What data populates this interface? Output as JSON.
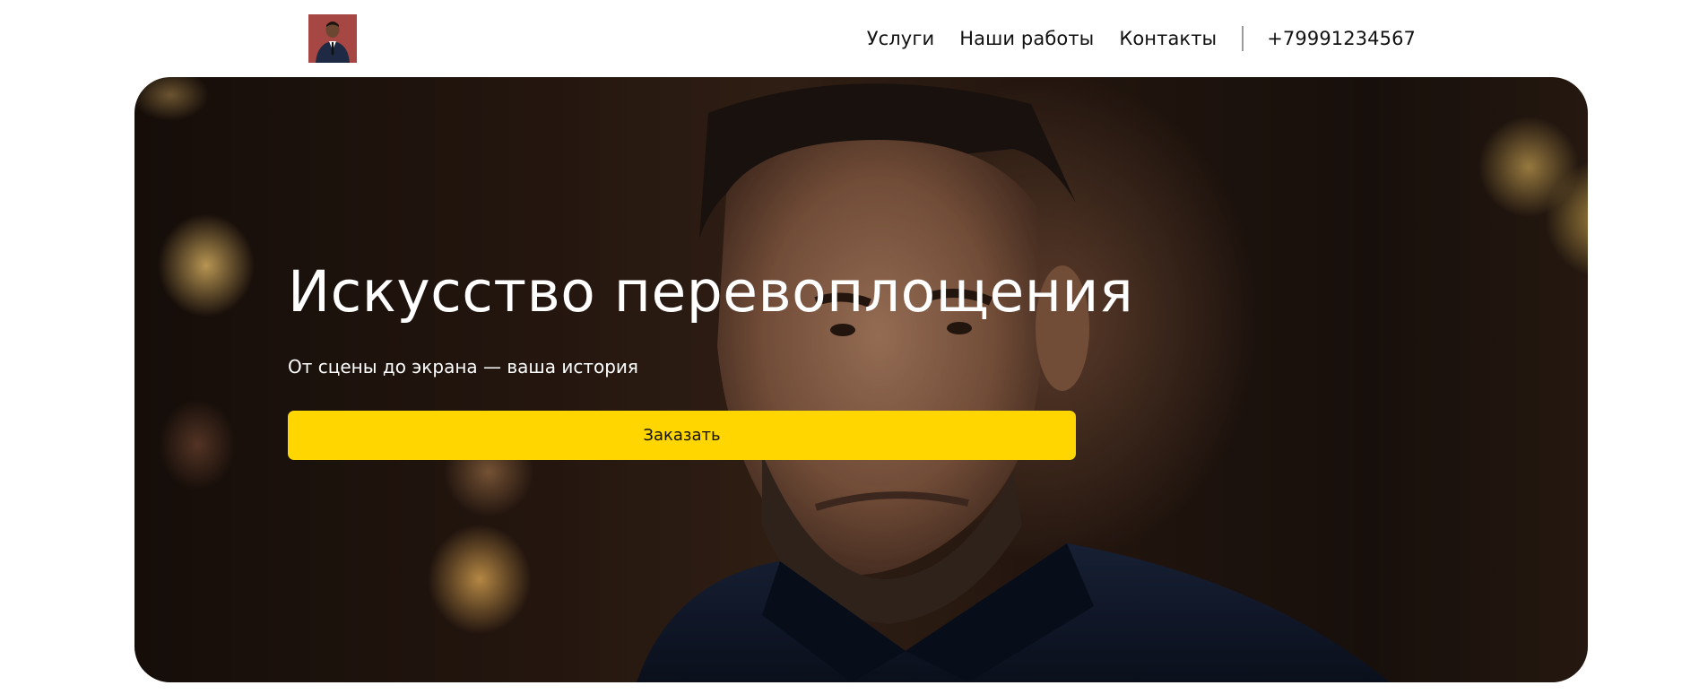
{
  "header": {
    "logo": {
      "icon": "man-in-suit-avatar"
    },
    "nav": [
      {
        "label": "Услуги"
      },
      {
        "label": "Наши работы"
      },
      {
        "label": "Контакты"
      }
    ],
    "phone": "+79991234567"
  },
  "hero": {
    "title": "Искусство перевоплощения",
    "subtitle": "От сцены до экрана — ваша история",
    "cta_label": "Заказать"
  },
  "colors": {
    "accent": "#ffd600",
    "text_dark": "#111111",
    "text_light": "#ffffff"
  }
}
